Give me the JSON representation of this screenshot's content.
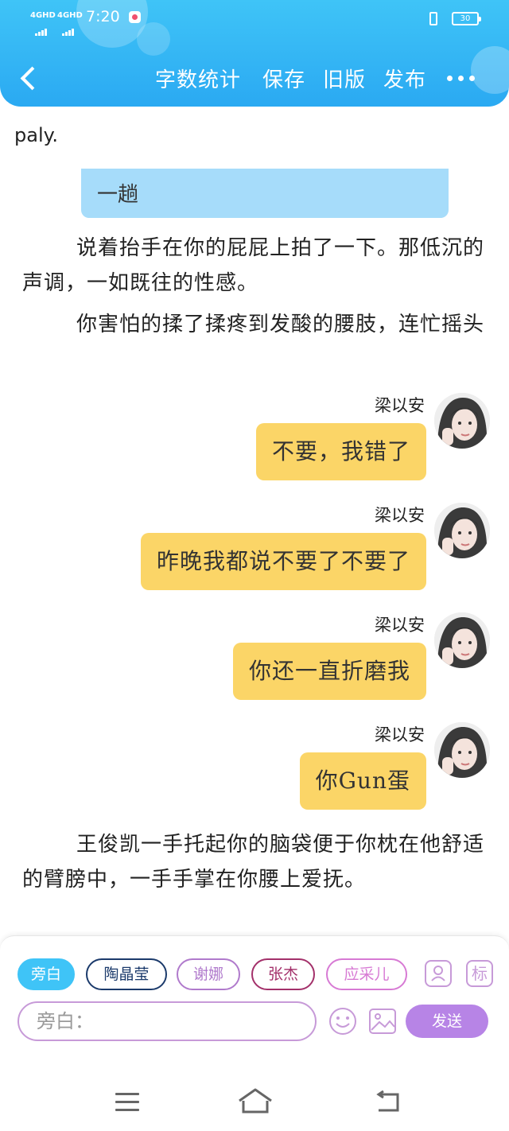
{
  "status_bar": {
    "signal_1": "4GHD",
    "signal_2": "4GHD",
    "time": "7:20",
    "battery": "30"
  },
  "header": {
    "back_icon": "chevron-left-icon",
    "actions": [
      "字数统计",
      "保存",
      "旧版",
      "发布"
    ],
    "more_icon": "more-horizontal-icon"
  },
  "content": {
    "fragment": "paly.",
    "top_bubble": "一趟",
    "narration_1": "说着抬手在你的屁屁上拍了一下。那低沉的声调，一如既往的性感。",
    "narration_2": "你害怕的揉了揉疼到发酸的腰肢，连忙摇头",
    "messages": [
      {
        "name": "梁以安",
        "text": "不要，我错了"
      },
      {
        "name": "梁以安",
        "text": "昨晚我都说不要了不要了"
      },
      {
        "name": "梁以安",
        "text": "你还一直折磨我"
      },
      {
        "name": "梁以安",
        "text": "你Gun蛋"
      }
    ],
    "narration_3": "王俊凯一手托起你的脑袋便于你枕在他舒适的臂膀中，一手手掌在你腰上爱抚。"
  },
  "input_area": {
    "characters": [
      {
        "label": "旁白",
        "color": "#3fc4f7"
      },
      {
        "label": "陶晶莹",
        "color": "#1b3a6b"
      },
      {
        "label": "谢娜",
        "color": "#b07acc"
      },
      {
        "label": "张杰",
        "color": "#a3306a"
      },
      {
        "label": "应采儿",
        "color": "#d77ad4"
      }
    ],
    "role_icon": "person-card-icon",
    "tag_label": "标",
    "placeholder": "旁白：",
    "emoji_icon": "smiley-icon",
    "image_icon": "image-icon",
    "send_label": "发送"
  },
  "nav_bar": {
    "icons": [
      "menu-icon",
      "home-icon",
      "back-icon"
    ]
  },
  "colors": {
    "header": "#33b4f4",
    "chat_bubble": "#fbd567",
    "narration_bubble": "#a6dcfa",
    "accent_purple": "#b784e6"
  }
}
